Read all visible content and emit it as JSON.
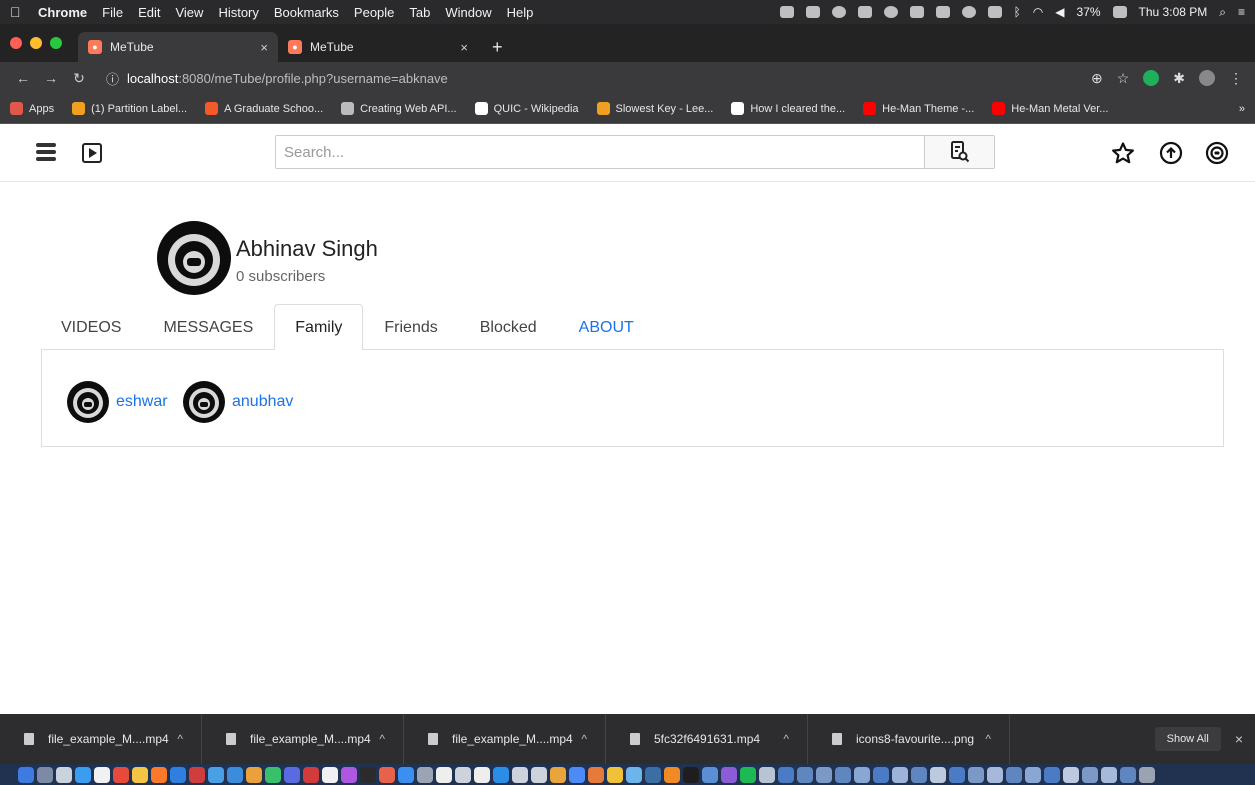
{
  "menubar": {
    "app": "Chrome",
    "items": [
      "File",
      "Edit",
      "View",
      "History",
      "Bookmarks",
      "People",
      "Tab",
      "Window",
      "Help"
    ],
    "battery": "37%",
    "clock": "Thu 3:08 PM"
  },
  "tabs": [
    {
      "title": "MeTube",
      "close": "×"
    },
    {
      "title": "MeTube",
      "close": "×"
    }
  ],
  "newtab": "+",
  "address": {
    "host": "localhost",
    "rest": ":8080/meTube/profile.php?username=abknave"
  },
  "bookmarks": [
    {
      "label": "Apps",
      "color": "#e0584a"
    },
    {
      "label": "(1) Partition Label...",
      "color": "#f0a020"
    },
    {
      "label": "A Graduate Schoo...",
      "color": "#f25a29"
    },
    {
      "label": "Creating Web API...",
      "color": "#bbbbbb"
    },
    {
      "label": "QUIC - Wikipedia",
      "color": "#ffffff"
    },
    {
      "label": "Slowest Key - Lee...",
      "color": "#f0a020"
    },
    {
      "label": "How I cleared the...",
      "color": "#ffffff"
    },
    {
      "label": "He-Man Theme -...",
      "color": "#ff0000"
    },
    {
      "label": "He-Man Metal Ver...",
      "color": "#ff0000"
    }
  ],
  "bookmarks_more": "»",
  "app": {
    "search_placeholder": "Search..."
  },
  "profile": {
    "name": "Abhinav Singh",
    "subscribers": "0 subscribers"
  },
  "profile_tabs": [
    {
      "label": "VIDEOS"
    },
    {
      "label": "MESSAGES"
    },
    {
      "label": "Family"
    },
    {
      "label": "Friends"
    },
    {
      "label": "Blocked"
    },
    {
      "label": "ABOUT"
    }
  ],
  "family": [
    {
      "name": "eshwar"
    },
    {
      "name": "anubhav"
    }
  ],
  "downloads": [
    {
      "file": "file_example_M....mp4",
      "caret": "^"
    },
    {
      "file": "file_example_M....mp4",
      "caret": "^"
    },
    {
      "file": "file_example_M....mp4",
      "caret": "^"
    },
    {
      "file": "5fc32f6491631.mp4",
      "caret": "^"
    },
    {
      "file": "icons8-favourite....png",
      "caret": "^"
    }
  ],
  "show_all": "Show All",
  "dl_close": "×"
}
